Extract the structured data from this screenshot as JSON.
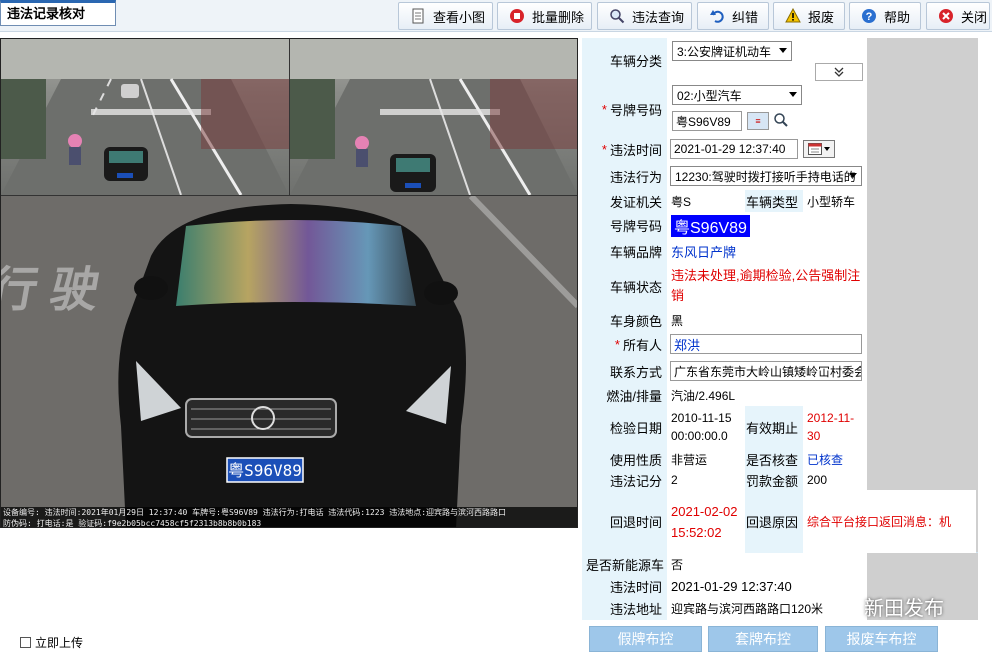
{
  "app": {
    "title": "违法记录核对"
  },
  "toolbar": {
    "view_thumbnails": "查看小图",
    "batch_delete": "批量删除",
    "violation_query": "违法查询",
    "correct": "纠错",
    "report_damage": "报废",
    "help": "帮助",
    "close": "关闭"
  },
  "photos": {
    "main_plate": "粤S96V89",
    "caption_line1": "设备编号:   违法时间:2021年01月29日 12:37:40  车牌号:粤S96V89  违法行为:打电话  违法代码:1223  违法地点:迎宾路与滨河西路路口",
    "caption_line2": "防伪码:  打电话:是  验证码:f9e2b05bcc7458cf5f2313b8b8b0b183"
  },
  "form": {
    "vehicle_category_label": "车辆分类",
    "vehicle_category_value": "3:公安牌证机动车",
    "plate_type_label": "号牌号码",
    "plate_type_value": "02:小型汽车",
    "plate_input_value": "粤S96V89",
    "violation_time_label": "违法时间",
    "violation_time_value": "2021-01-29 12:37:40",
    "violation_act_label": "违法行为",
    "violation_act_value": "12230:驾驶时拨打接听手持电话的",
    "issuing_office_label": "发证机关",
    "issuing_office_value": "粤S",
    "vehicle_type_label": "车辆类型",
    "vehicle_type_value": "小型轿车",
    "plate_number_label": "号牌号码",
    "plate_number_value": "粤S96V89",
    "brand_label": "车辆品牌",
    "brand_value": "东风日产牌",
    "status_label": "车辆状态",
    "status_value": "违法未处理,逾期检验,公告强制注销",
    "color_label": "车身颜色",
    "color_value": "黑",
    "owner_label": "所有人",
    "owner_value": "郑洪",
    "contact_label": "联系方式",
    "contact_value": "广东省东莞市大岭山镇矮岭冚村委会",
    "fuel_label": "燃油/排量",
    "fuel_value": "汽油/2.496L",
    "inspection_date_label": "检验日期",
    "inspection_date_value": "2010-11-15 00:00:00.0",
    "valid_until_label": "有效期止",
    "valid_until_value": "2012-11-30",
    "usage_label": "使用性质",
    "usage_value": "非营运",
    "verified_label": "是否核查",
    "verified_value": "已核查",
    "points_label": "违法记分",
    "points_value": "2",
    "fine_label": "罚款金额",
    "fine_value": "200",
    "return_time_label": "回退时间",
    "return_time_value": "2021-02-02 15:52:02",
    "return_reason_label": "回退原因",
    "return_reason_value": "综合平台接口返回消息：机",
    "new_energy_label": "是否新能源车",
    "new_energy_value": "否",
    "time2_label": "违法时间",
    "time2_value": "2021-01-29 12:37:40",
    "location_label": "违法地址",
    "location_value": "迎宾路与滨河西路路口120米"
  },
  "bottom": {
    "upload_now": "立即上传",
    "fake_plate_control": "假牌布控",
    "cloned_plate_control": "套牌布控",
    "scrapped_control": "报废车布控"
  },
  "watermark": {
    "text": "新田发布"
  }
}
